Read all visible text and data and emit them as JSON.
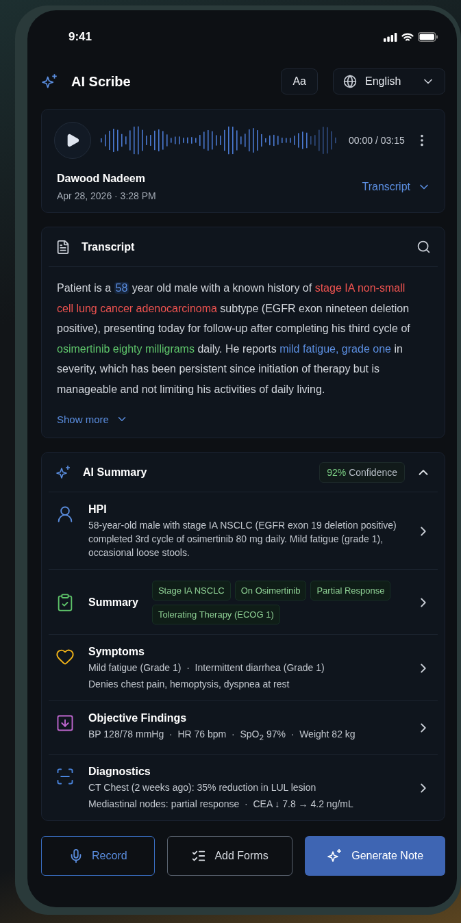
{
  "status_bar": {
    "time": "9:41"
  },
  "header": {
    "title": "AI Scribe",
    "font_button": "Aa",
    "language": "English"
  },
  "player": {
    "time": "00:00 / 03:15",
    "patient": "Dawood Nadeem",
    "date": "Apr 28, 2026 · 3:28 PM",
    "view": "Transcript"
  },
  "transcript": {
    "title": "Transcript",
    "segments": [
      {
        "text": "Patient is a ",
        "kind": "plain"
      },
      {
        "text": "58",
        "kind": "age"
      },
      {
        "text": " year old male with a known history of ",
        "kind": "plain"
      },
      {
        "text": "stage IA non-small cell lung cancer adenocarcinoma",
        "kind": "condition"
      },
      {
        "text": " subtype (EGFR exon nineteen deletion positive), presenting today for follow-up after completing his third cycle of ",
        "kind": "plain"
      },
      {
        "text": "osimertinib eighty milligrams",
        "kind": "medication"
      },
      {
        "text": " daily. He reports ",
        "kind": "plain"
      },
      {
        "text": "mild fatigue, grade one",
        "kind": "symptom"
      },
      {
        "text": " in severity, which has been persistent since initiation of therapy but is manageable and not limiting his activities of daily living.",
        "kind": "plain"
      }
    ],
    "show_more": "Show more"
  },
  "summary": {
    "title": "AI Summary",
    "confidence_value": "92%",
    "confidence_label": "Confidence",
    "expanded": true,
    "sections": [
      {
        "kind": "hpi",
        "title": "HPI",
        "text": "58-year-old male with stage IA NSCLC (EGFR exon 19 deletion positive) completed 3rd cycle of osimertinib 80 mg daily. Mild fatigue (grade 1), occasional loose stools."
      },
      {
        "kind": "summary",
        "title": "Summary",
        "tags": [
          "Stage IA NSCLC",
          "On Osimertinib",
          "Partial Response",
          "Tolerating Therapy (ECOG 1)"
        ]
      },
      {
        "kind": "symptoms",
        "title": "Symptoms",
        "lines": [
          "Mild fatigue (Grade 1)  ·  Intermittent diarrhea (Grade 1)",
          "Denies chest pain, hemoptysis, dyspnea at rest"
        ]
      },
      {
        "kind": "objective",
        "title": "Objective Findings",
        "lines": [
          "BP 128/78 mmHg  ·  HR 76 bpm  ·  SpO$_{2}$ 97%  ·  Weight 82 kg"
        ]
      },
      {
        "kind": "diagnostics",
        "title": "Diagnostics",
        "lines": [
          "CT Chest (2 weeks ago): 35% reduction in LUL lesion",
          "Mediastinal nodes: partial response  ·  CEA ↓ 7.8 → 4.2 ng/mL"
        ]
      }
    ]
  },
  "actions": [
    {
      "kind": "record",
      "label": "Record"
    },
    {
      "kind": "forms",
      "label": "Add Forms"
    },
    {
      "kind": "generate",
      "label": "Generate Note"
    }
  ]
}
